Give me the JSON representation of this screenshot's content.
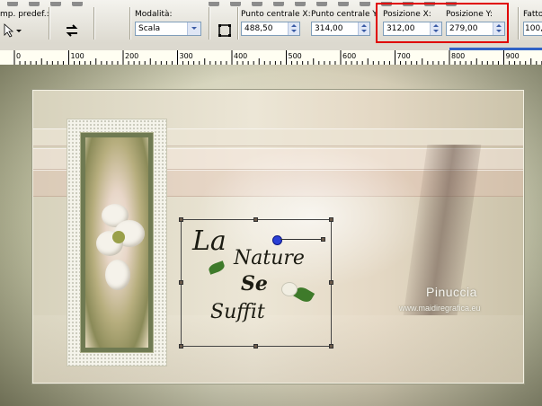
{
  "toolbar": {
    "preset_label": "mp. predef.:",
    "mode_label": "Modalità:",
    "mode_value": "Scala",
    "center_x_label": "Punto centrale X:",
    "center_x_value": "488,50",
    "center_y_label": "Punto centrale Y",
    "center_y_value": "314,00",
    "pos_x_label": "Posizione X:",
    "pos_x_value": "312,00",
    "pos_y_label": "Posizione Y:",
    "pos_y_value": "279,00",
    "factor_label": "Fatto",
    "factor_value": "100,"
  },
  "ruler": {
    "ticks": [
      "0",
      "100",
      "200",
      "300",
      "400",
      "500",
      "600",
      "700",
      "800",
      "900"
    ]
  },
  "canvas": {
    "title_line1": "La",
    "title_line2": "Nature",
    "title_line3": "Se",
    "title_line4": "Suffit",
    "signature": "Pinuccia",
    "website": "www.maidiregrafica.eu"
  },
  "colors": {
    "highlight": "#e00000",
    "ruler_accent": "#3162c6"
  }
}
